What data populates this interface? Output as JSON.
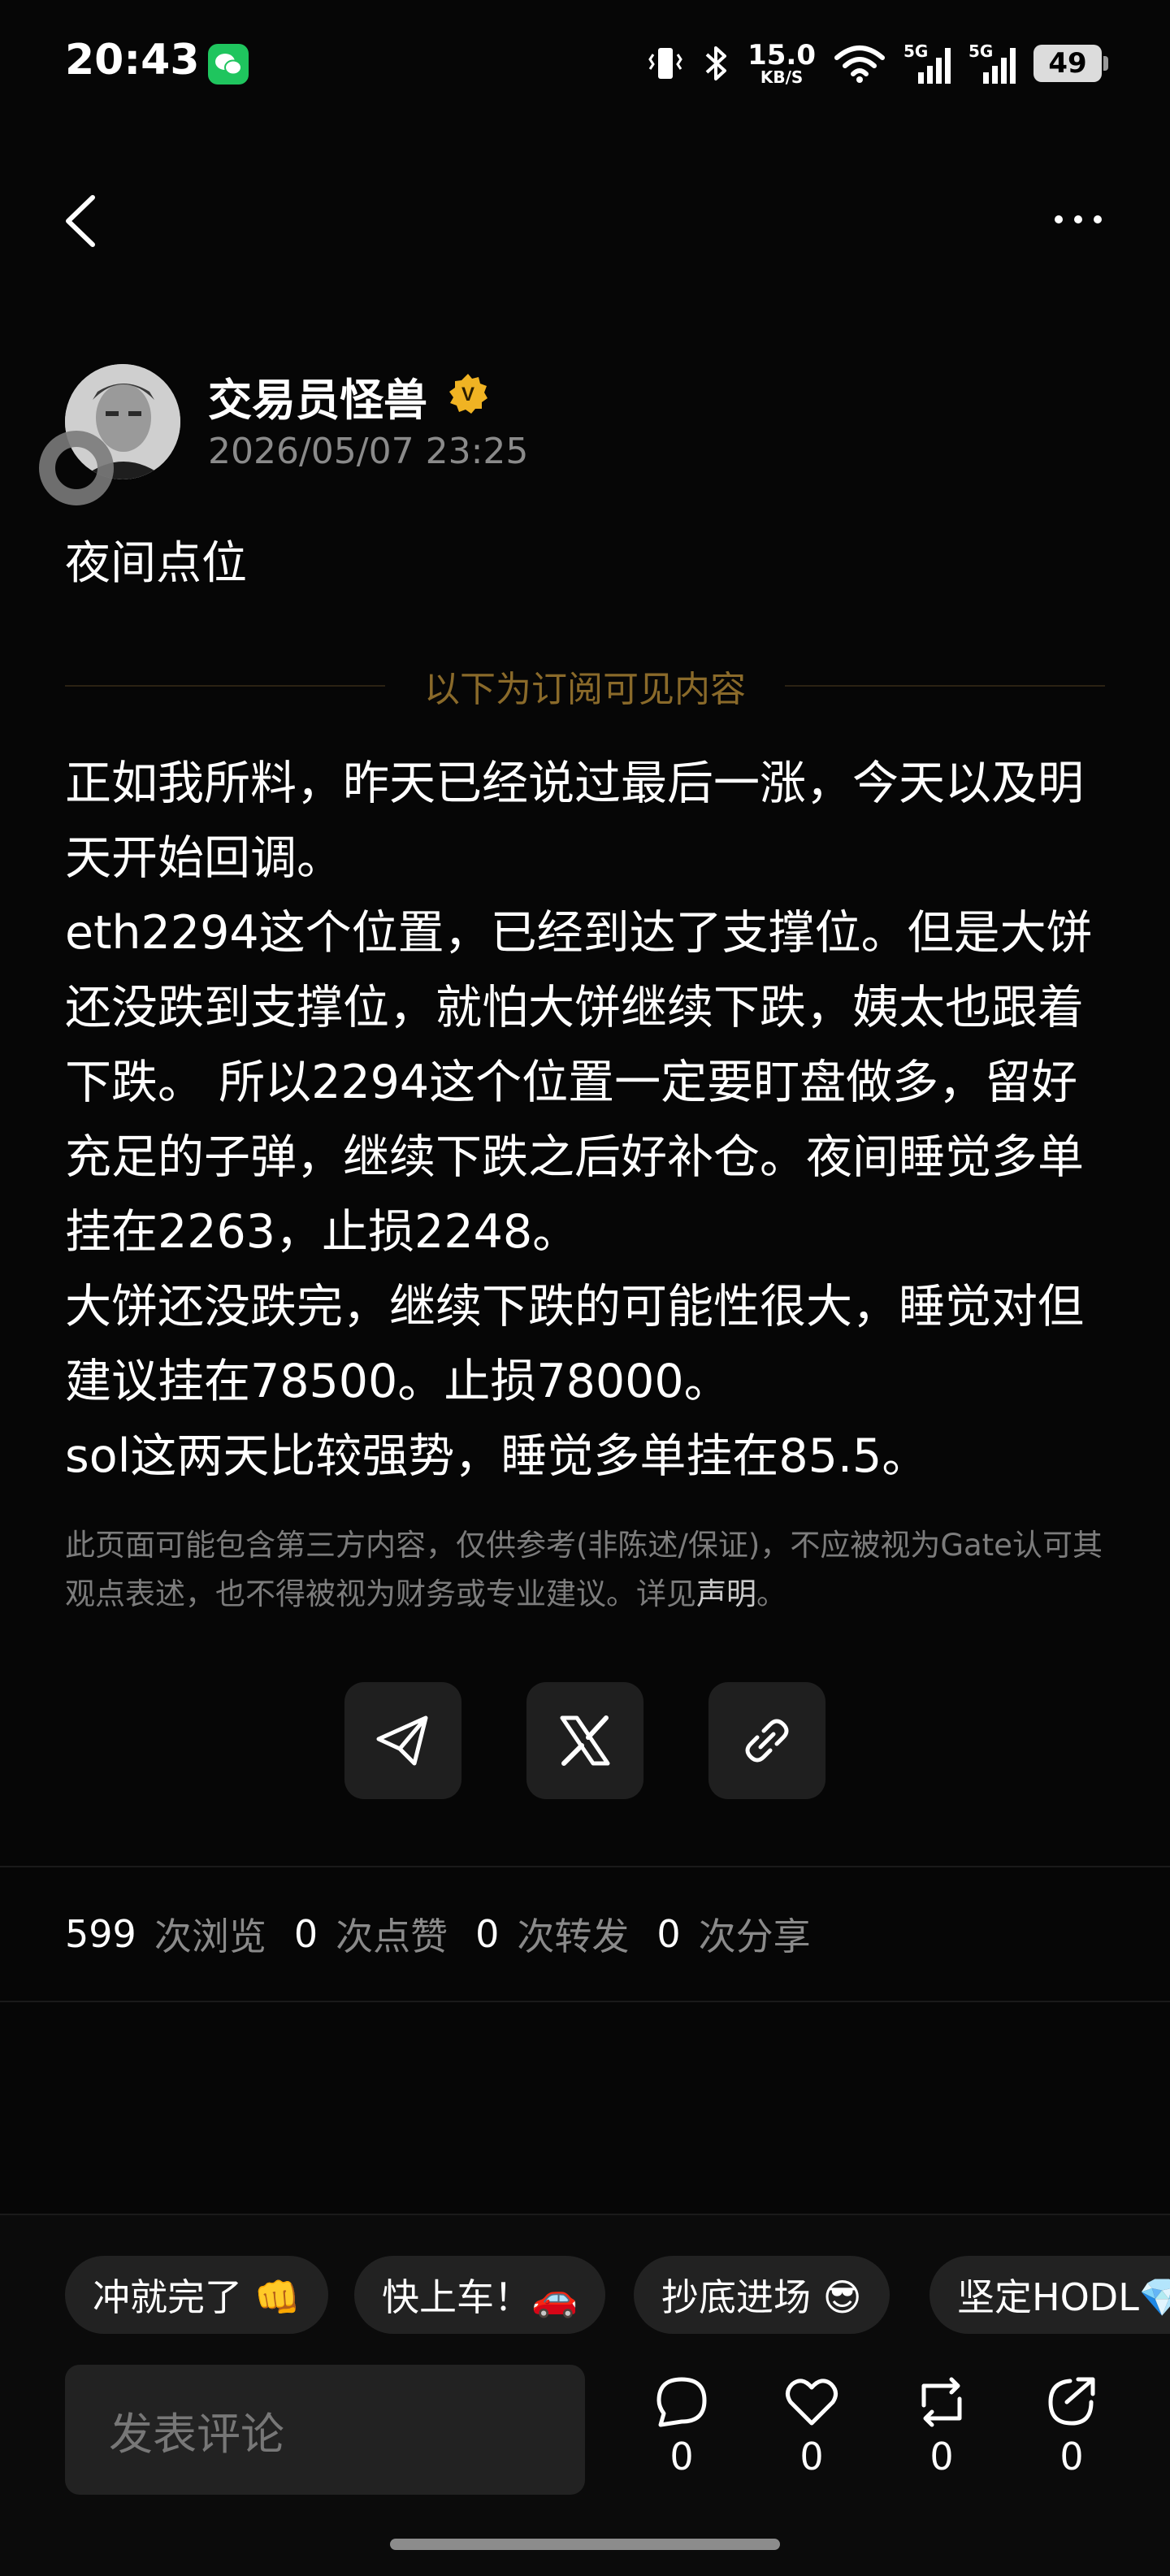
{
  "status_bar": {
    "time": "20:43",
    "net_speed_value": "15.0",
    "net_speed_unit": "KB/S",
    "sim1": "5G",
    "sim2": "5G",
    "battery": "49"
  },
  "author": {
    "name": "交易员怪兽",
    "verified_badge": "V",
    "timestamp": "2026/05/07 23:25"
  },
  "post": {
    "title": "夜间点位",
    "subscribe_divider": "以下为订阅可见内容",
    "paragraphs": [
      "正如我所料，昨天已经说过最后一涨，今天以及明天开始回调。",
      "eth2294这个位置，已经到达了支撑位。但是大饼还没跌到支撑位，就怕大饼继续下跌，姨太也跟着下跌。 所以2294这个位置一定要盯盘做多，留好充足的子弹，继续下跌之后好补仓。夜间睡觉多单挂在2263，止损2248。",
      "大饼还没跌完，继续下跌的可能性很大，睡觉对但建议挂在78500。止损78000。",
      "sol这两天比较强势，睡觉多单挂在85.5。"
    ],
    "disclaimer_text": "此页面可能包含第三方内容，仅供参考(非陈述/保证)，不应被视为Gate认可其观点表述，也不得被视为财务或专业建议。详见",
    "disclaimer_link": "声明",
    "disclaimer_end": "。"
  },
  "stats": {
    "views": "599",
    "views_label": "次浏览",
    "likes": "0",
    "likes_label": "次点赞",
    "reposts": "0",
    "reposts_label": "次转发",
    "shares": "0",
    "shares_label": "次分享"
  },
  "quick_replies": [
    "冲就完了 👊",
    "快上车！🚗",
    "抄底进场 😎",
    "坚定HODL💎"
  ],
  "comment_placeholder": "发表评论",
  "actions": {
    "comments": "0",
    "likes": "0",
    "reposts": "0",
    "shares": "0"
  },
  "colors": {
    "background": "#060606",
    "accent_gold": "#8a6a2a",
    "muted_text": "#8a8a8a",
    "chip_bg": "#222222"
  }
}
